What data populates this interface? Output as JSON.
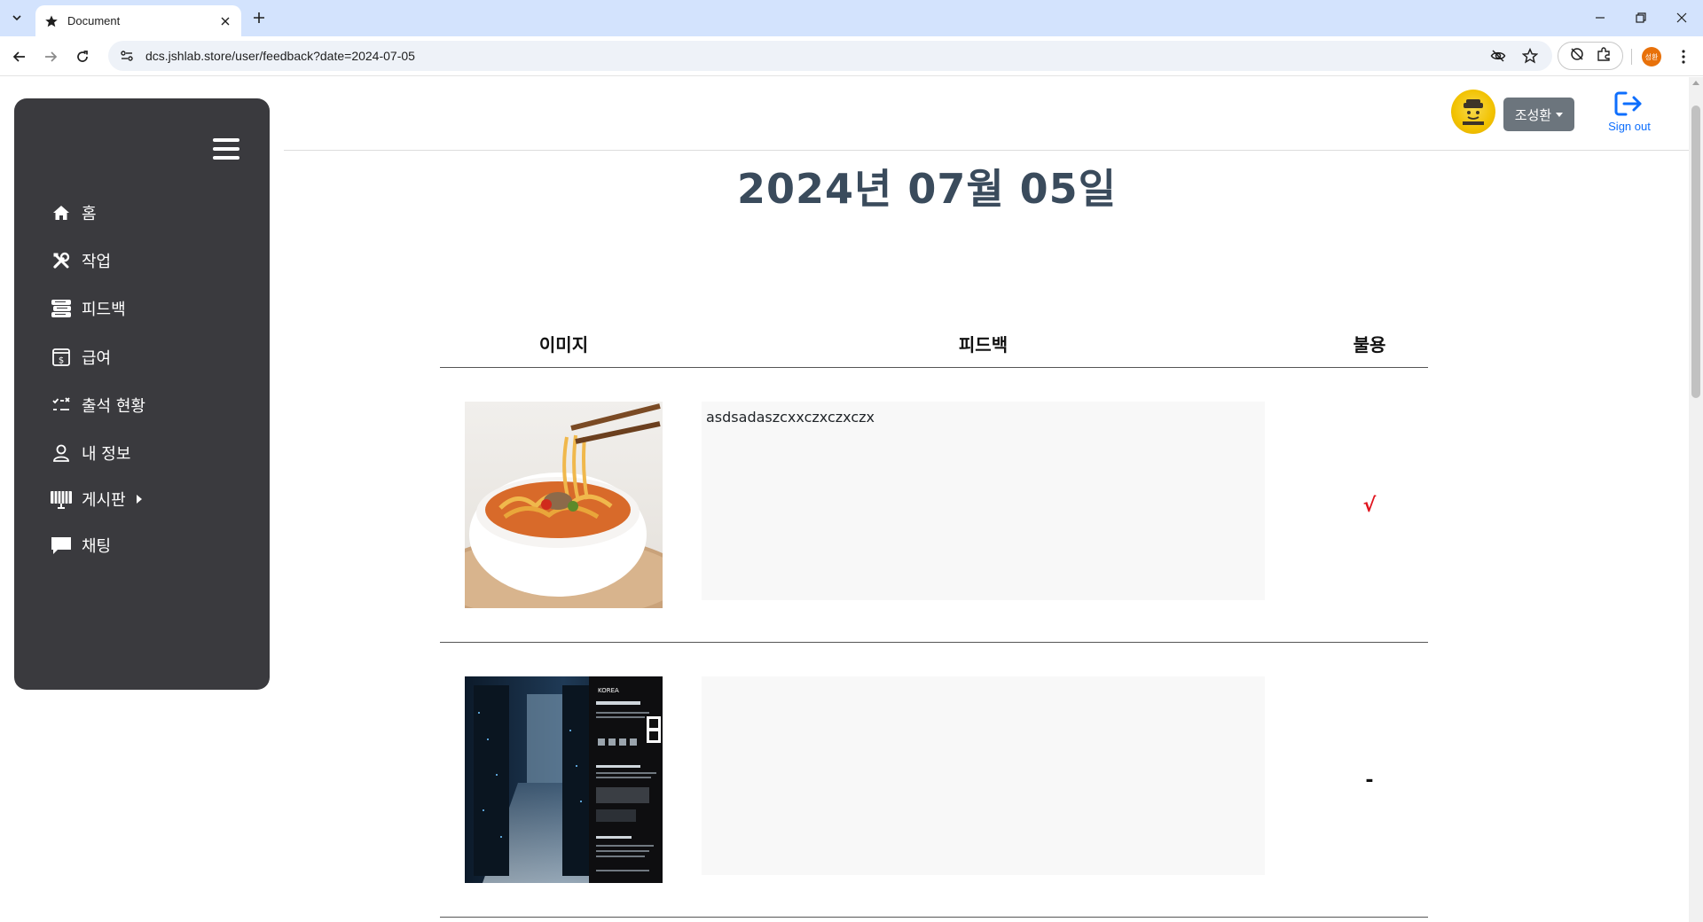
{
  "browser": {
    "tab_title": "Document",
    "url": "dcs.jshlab.store/user/feedback?date=2024-07-05",
    "profile_label": "성환"
  },
  "sidebar": {
    "items": [
      {
        "label": "홈",
        "icon": "home-icon"
      },
      {
        "label": "작업",
        "icon": "tools-icon"
      },
      {
        "label": "피드백",
        "icon": "feedback-icon"
      },
      {
        "label": "급여",
        "icon": "salary-icon"
      },
      {
        "label": "출석 현황",
        "icon": "attendance-icon"
      },
      {
        "label": "내 정보",
        "icon": "user-icon"
      },
      {
        "label": "게시판",
        "icon": "board-icon",
        "has_submenu": true
      },
      {
        "label": "채팅",
        "icon": "chat-icon"
      }
    ]
  },
  "header": {
    "user_name": "조성환",
    "signout_label": "Sign out"
  },
  "page": {
    "title": "2024년 07월 05일"
  },
  "table": {
    "headers": [
      "이미지",
      "피드백",
      "불용"
    ],
    "rows": [
      {
        "image": "ramen-bowl-photo",
        "feedback": "asdsadaszcxxczxczxczx",
        "status": "√",
        "status_color": "#e0141e"
      },
      {
        "image": "server-room-poster",
        "feedback": "",
        "status": "-",
        "status_color": "#111111"
      }
    ]
  },
  "colors": {
    "sidebar_bg": "#3a3a3e",
    "accent": "#0d6efd",
    "title": "#3a4b5c",
    "user_button": "#6c757d"
  }
}
